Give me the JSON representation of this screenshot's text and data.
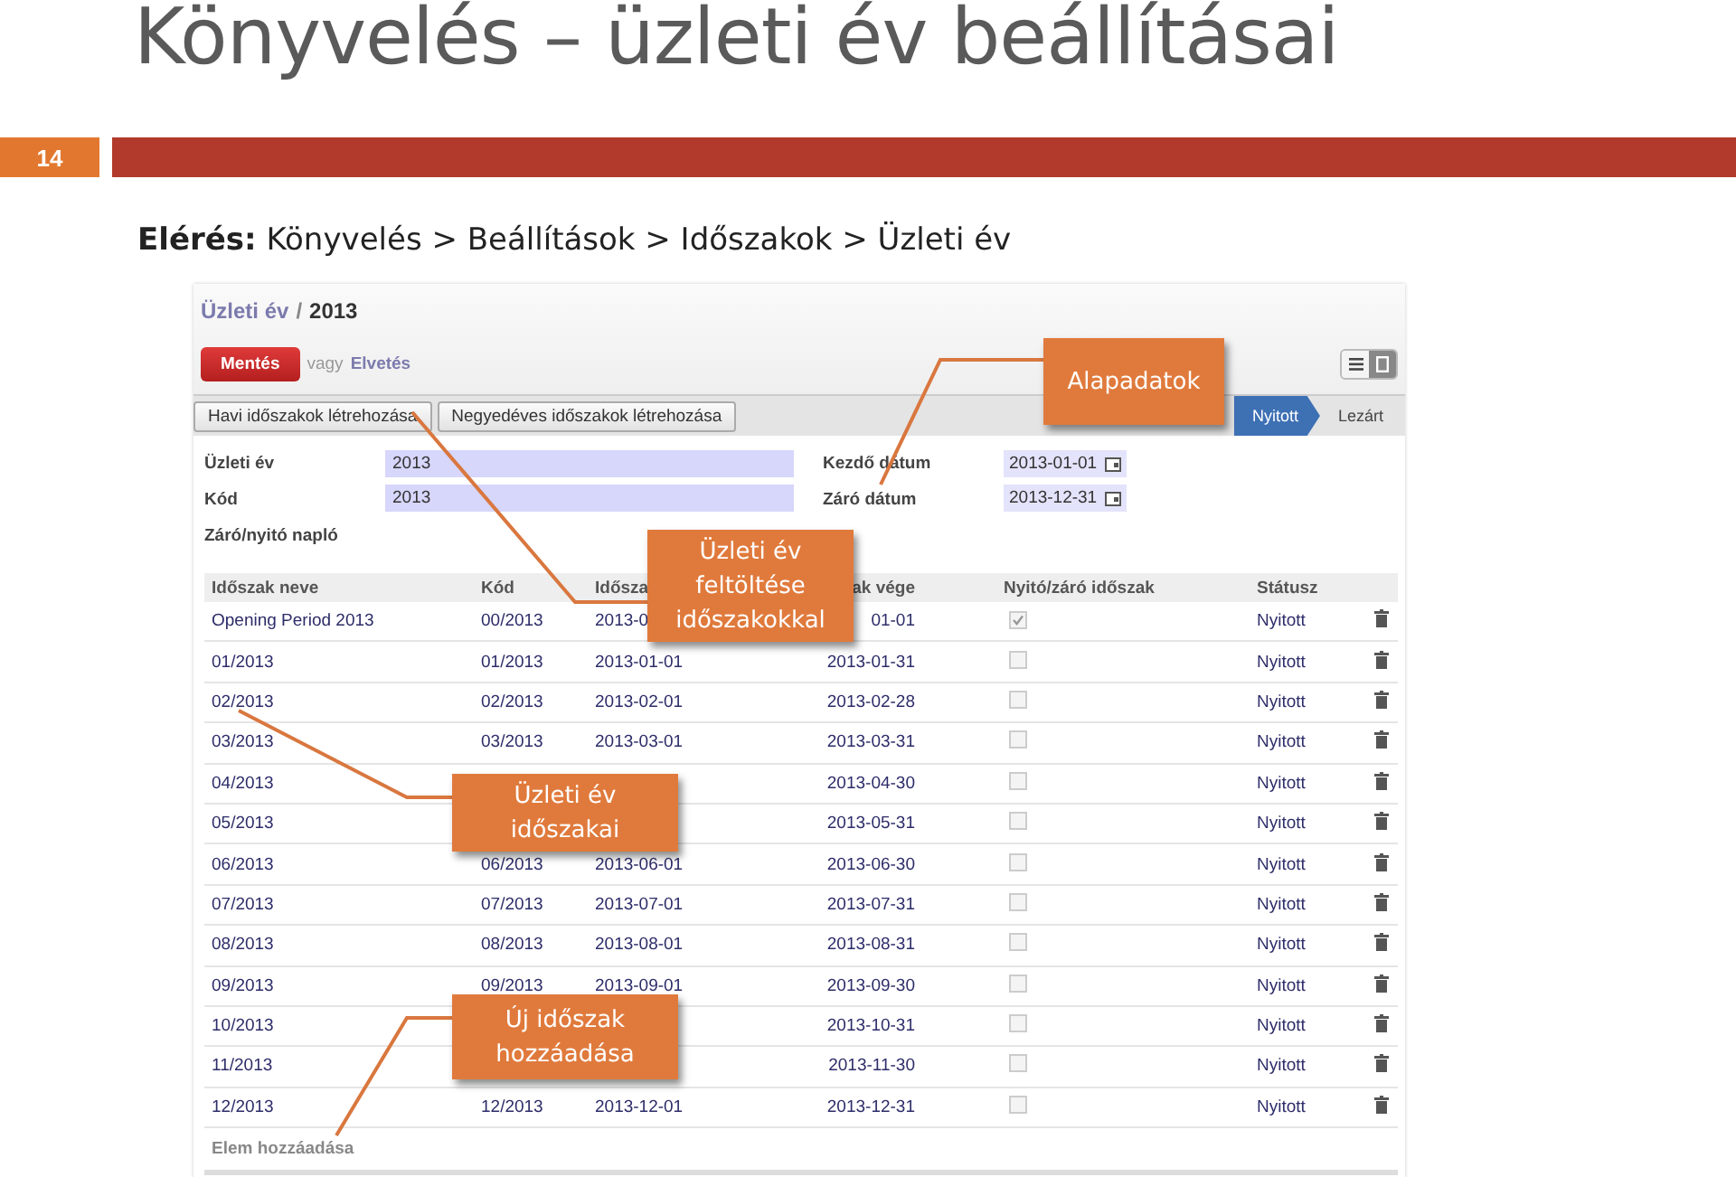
{
  "slide": {
    "title": "Könyvelés – üzleti év beállításai",
    "number": "14"
  },
  "access": {
    "label": "Elérés:",
    "path": "Könyvelés > Beállítások > Időszakok > Üzleti év"
  },
  "app": {
    "breadcrumb": {
      "parent": "Üzleti év",
      "separator": "/",
      "current": "2013"
    },
    "save_button": "Mentés",
    "or_text": "vagy",
    "discard_link": "Elvetés",
    "views": [
      {
        "kind": "list",
        "selected": false
      },
      {
        "kind": "form",
        "selected": true
      }
    ],
    "action_buttons": [
      "Havi időszakok létrehozása",
      "Negyedéves időszakok létrehozása"
    ],
    "status_steps": [
      {
        "label": "Nyitott",
        "selected": true
      },
      {
        "label": "Lezárt",
        "selected": false
      }
    ],
    "form_left": [
      {
        "label": "Üzleti év",
        "value": "2013"
      },
      {
        "label": "Kód",
        "value": "2013"
      },
      {
        "label": "Záró/nyitó napló"
      }
    ],
    "form_right": [
      {
        "label": "Kezdő dátum",
        "value": "2013-01-01"
      },
      {
        "label": "Záró dátum",
        "value": "2013-12-31"
      }
    ],
    "table": {
      "columns": [
        "Időszak neve",
        "Kód",
        "Idősza",
        "ak vége",
        "Nyitó/záró időszak",
        "Státusz"
      ],
      "rows": [
        {
          "name": "Opening Period 2013",
          "code": "00/2013",
          "start": "2013-0",
          "end": "01-01",
          "checked": true,
          "status": "Nyitott"
        },
        {
          "name": "01/2013",
          "code": "01/2013",
          "start": "2013-01-01",
          "end": "2013-01-31",
          "checked": false,
          "status": "Nyitott"
        },
        {
          "name": "02/2013",
          "code": "02/2013",
          "start": "2013-02-01",
          "end": "2013-02-28",
          "checked": false,
          "status": "Nyitott"
        },
        {
          "name": "03/2013",
          "code": "03/2013",
          "start": "2013-03-01",
          "end": "2013-03-31",
          "checked": false,
          "status": "Nyitott"
        },
        {
          "name": "04/2013",
          "end": "2013-04-30",
          "checked": false,
          "status": "Nyitott"
        },
        {
          "name": "05/2013",
          "end": "2013-05-31",
          "checked": false,
          "status": "Nyitott"
        },
        {
          "name": "06/2013",
          "code": "06/2013",
          "start": "2013-06-01",
          "end": "2013-06-30",
          "checked": false,
          "status": "Nyitott"
        },
        {
          "name": "07/2013",
          "code": "07/2013",
          "start": "2013-07-01",
          "end": "2013-07-31",
          "checked": false,
          "status": "Nyitott"
        },
        {
          "name": "08/2013",
          "code": "08/2013",
          "start": "2013-08-01",
          "end": "2013-08-31",
          "checked": false,
          "status": "Nyitott"
        },
        {
          "name": "09/2013",
          "code": "09/2013",
          "start": "2013-09-01",
          "end": "2013-09-30",
          "checked": false,
          "status": "Nyitott"
        },
        {
          "name": "10/2013",
          "end": "2013-10-31",
          "checked": false,
          "status": "Nyitott"
        },
        {
          "name": "11/2013",
          "end": "2013-11-30",
          "checked": false,
          "status": "Nyitott"
        },
        {
          "name": "12/2013",
          "code": "12/2013",
          "start": "2013-12-01",
          "end": "2013-12-31",
          "checked": false,
          "status": "Nyitott"
        }
      ]
    },
    "add_item": "Elem hozzáadása"
  },
  "callouts": [
    {
      "text": "Alapadatok"
    },
    {
      "text": "Üzleti év feltöltése időszakokkal"
    },
    {
      "text": "Üzleti év időszakai"
    },
    {
      "text": "Új időszak hozzáadása"
    }
  ]
}
